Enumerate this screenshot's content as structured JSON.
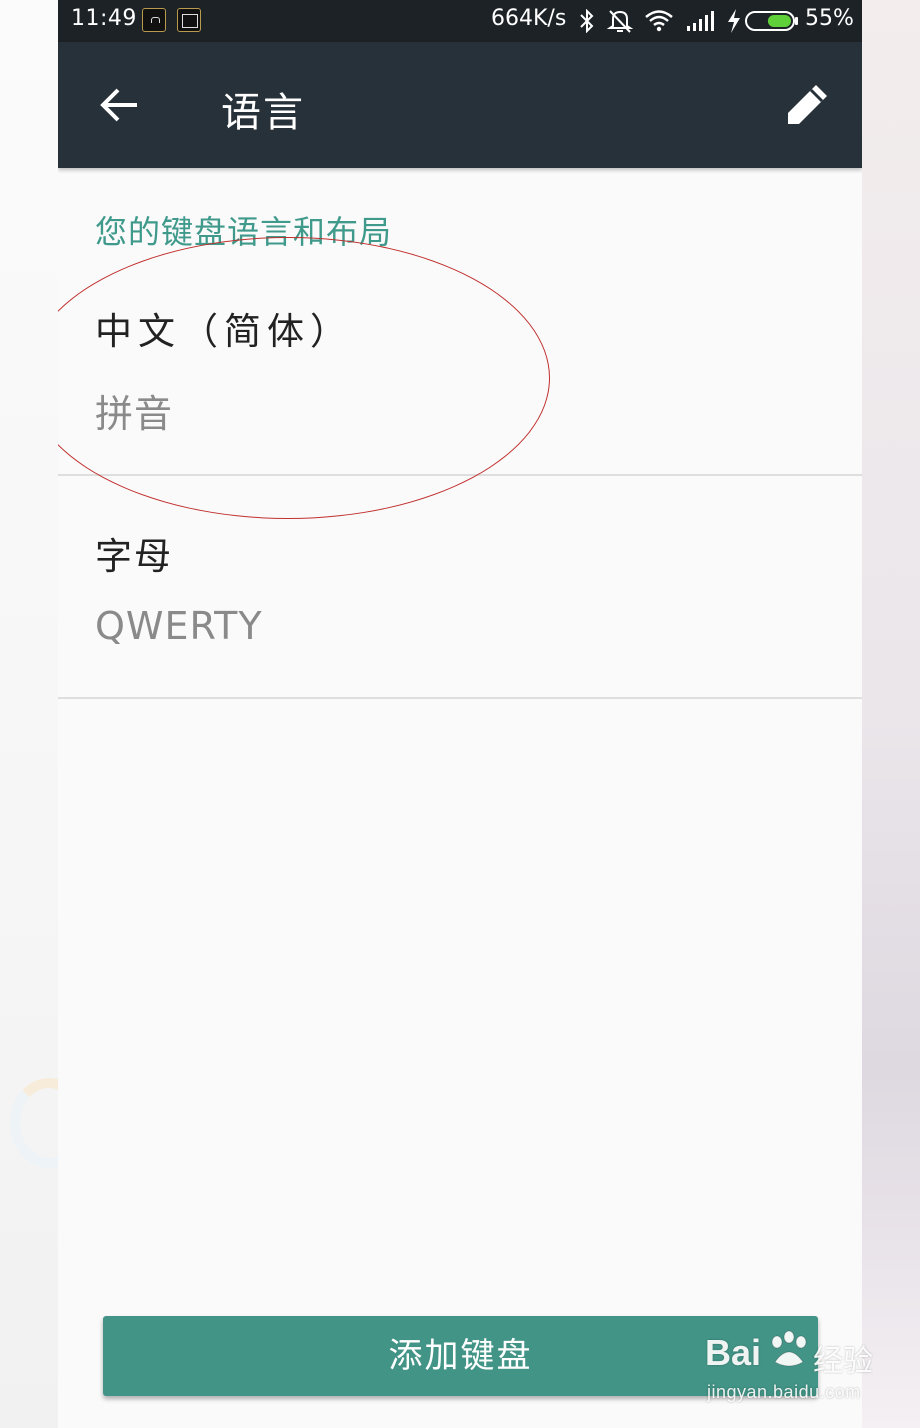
{
  "status_bar": {
    "time": "11:49",
    "network_speed": "664K/s",
    "battery_percent": "55%",
    "battery_level": 0.55,
    "icons": [
      "app-notification-icon",
      "screenshot-notification-icon",
      "bluetooth-icon",
      "silent-bell-icon",
      "wifi-icon",
      "signal-icon",
      "charging-bolt-icon",
      "battery-icon"
    ]
  },
  "app_bar": {
    "title": "语言",
    "back_icon": "arrow-left-icon",
    "edit_icon": "pencil-icon"
  },
  "section": {
    "header": "您的键盘语言和布局"
  },
  "languages": [
    {
      "name": "中文（简体）",
      "layout": "拼音"
    },
    {
      "name": "字母",
      "layout": "QWERTY"
    }
  ],
  "add_button": {
    "label": "添加键盘"
  },
  "watermark": {
    "brand_left": "Bai",
    "brand_right": "经验",
    "url": "jingyan.baidu.com"
  },
  "colors": {
    "status_bar": "#1c2226",
    "app_bar": "#273139",
    "accent": "#3f9a8c",
    "button": "#429486",
    "annotation": "#c0302e",
    "battery": "#5fcf3a"
  }
}
